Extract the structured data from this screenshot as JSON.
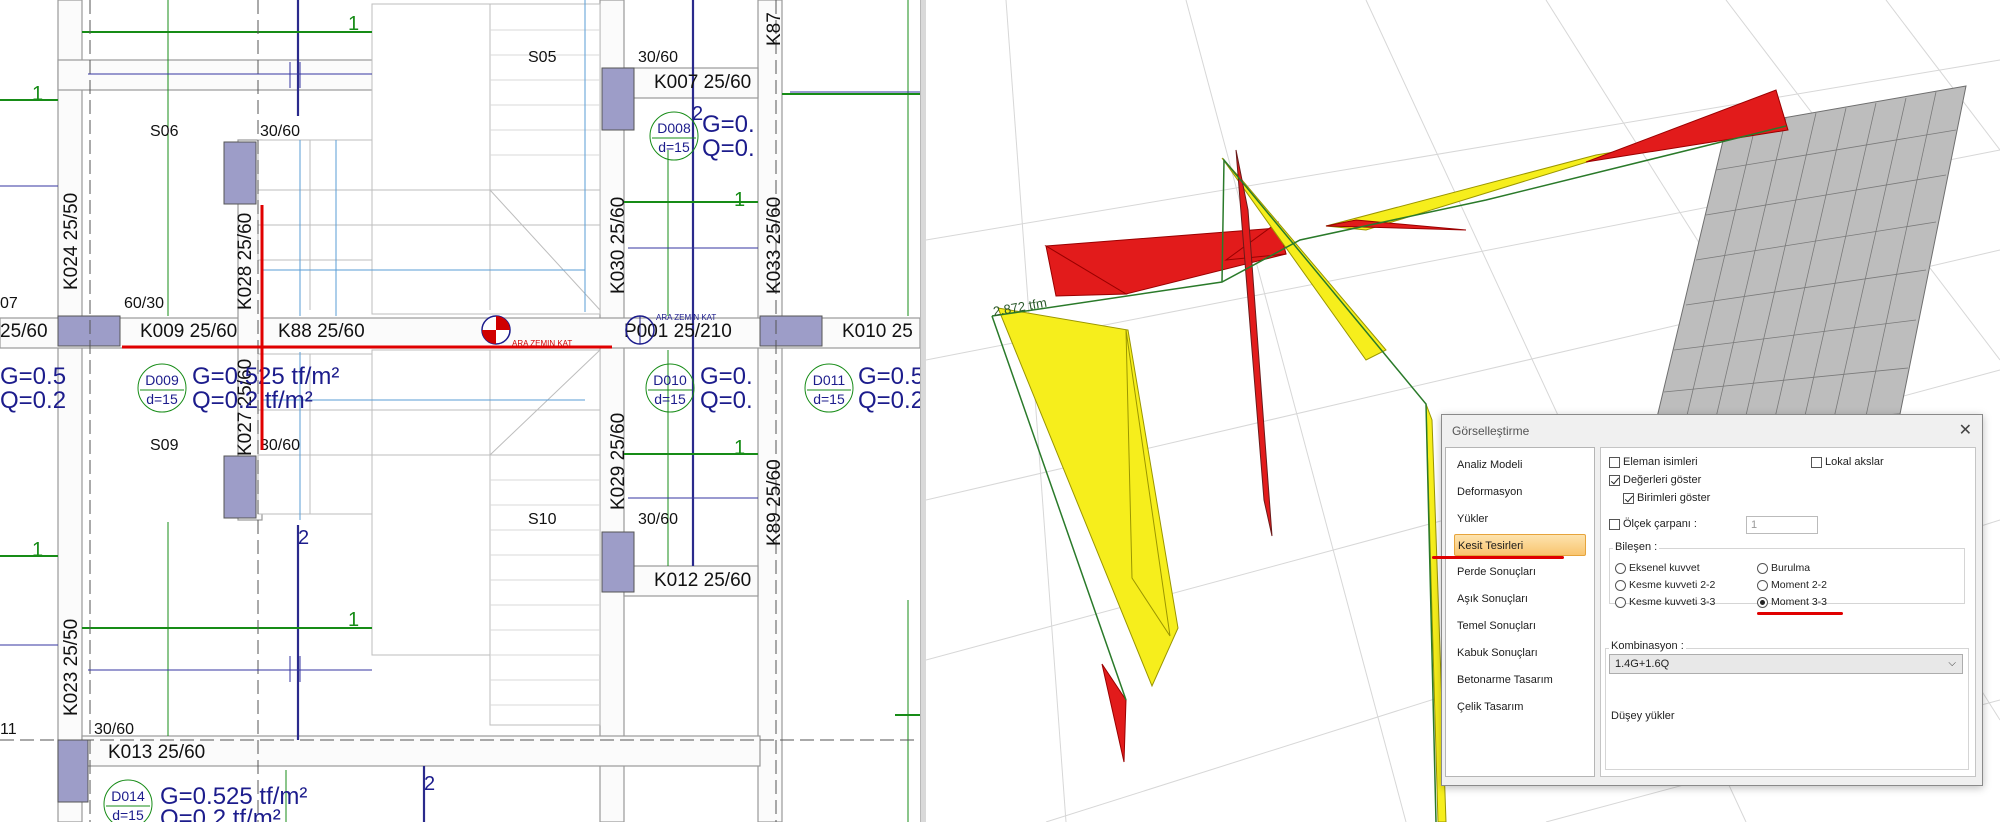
{
  "plan": {
    "beams": {
      "k009": "K009 25/60",
      "k88": "K88 25/60",
      "p001": "P001 25/210",
      "k010": "K010 25",
      "k007": "K007 25/60",
      "k012": "K012 25/60",
      "k013": "K013 25/60",
      "k024": "K024 25/50",
      "k023": "K023 25/50",
      "k028": "K028 25/60",
      "k027": "K027 25/60",
      "k030": "K030 25/60",
      "k029": "K029 25/60",
      "k033": "K033 25/60",
      "k089": "K89 25/60",
      "k087": "K87",
      "left_cut": "25/60"
    },
    "spaces": {
      "s05": "S05",
      "s06": "S06",
      "s09": "S09",
      "s10": "S10"
    },
    "columns": {
      "c1": "30/60",
      "c2": "30/60",
      "c3": "30/60",
      "c4": "30/60",
      "c5": "30/60",
      "c6": "60/30",
      "c7": "07",
      "c8": "11"
    },
    "slabs": {
      "d009": {
        "id": "D009",
        "d": "d=15",
        "g": "G=0.525 tf/m²",
        "q": "Q=0.2 tf/m²"
      },
      "d008": {
        "id": "D008",
        "d": "d=15",
        "g": "G=0.",
        "q": "Q=0."
      },
      "d010": {
        "id": "D010",
        "d": "d=15",
        "g": "G=0.",
        "q": "Q=0."
      },
      "d011": {
        "id": "D011",
        "d": "d=15",
        "g": "G=0.5",
        "q": "Q=0.2"
      },
      "d014": {
        "id": "D014",
        "d": "d=15",
        "g": "G=0.525 tf/m²",
        "q": "Q=0.2 tf/m²"
      },
      "left_g": "G=0.5",
      "left_q": "Q=0.2"
    },
    "load_numbers": {
      "one": "1",
      "two": "2"
    },
    "floor_labels": {
      "a": "ARA ZEMIN KAT",
      "b": "ARA ZEMIN KAT"
    }
  },
  "view3d": {
    "moment_label": "2.872 tfm"
  },
  "dialog": {
    "title": "Görselleştirme",
    "close": "✕",
    "nav": [
      "Analiz Modeli",
      "Deformasyon",
      "Yükler",
      "Kesit Tesirleri",
      "Perde Sonuçları",
      "Aşık Sonuçları",
      "Temel Sonuçları",
      "Kabuk Sonuçları",
      "Betonarme Tasarım",
      "Çelik Tasarım"
    ],
    "active_nav_index": 3,
    "options": {
      "eleman_isimleri": {
        "label": "Eleman isimleri",
        "checked": false
      },
      "lokal_akslar": {
        "label": "Lokal akslar",
        "checked": false
      },
      "degerleri_goster": {
        "label": "Değerleri göster",
        "checked": true
      },
      "birimleri_goster": {
        "label": "Birimleri göster",
        "checked": true
      },
      "olcek_carpani": {
        "label": "Ölçek çarpanı :",
        "checked": false,
        "value": "1"
      }
    },
    "bilesen": {
      "label": "Bileşen :",
      "items": [
        {
          "label": "Eksenel kuvvet",
          "selected": false
        },
        {
          "label": "Kesme kuvveti 2-2",
          "selected": false
        },
        {
          "label": "Kesme kuvveti 3-3",
          "selected": false
        },
        {
          "label": "Burulma",
          "selected": false
        },
        {
          "label": "Moment 2-2",
          "selected": false
        },
        {
          "label": "Moment 3-3",
          "selected": true
        }
      ]
    },
    "kombinasyon": {
      "label": "Kombinasyon :",
      "value": "1.4G+1.6Q",
      "description": "Düşey yükler"
    }
  }
}
